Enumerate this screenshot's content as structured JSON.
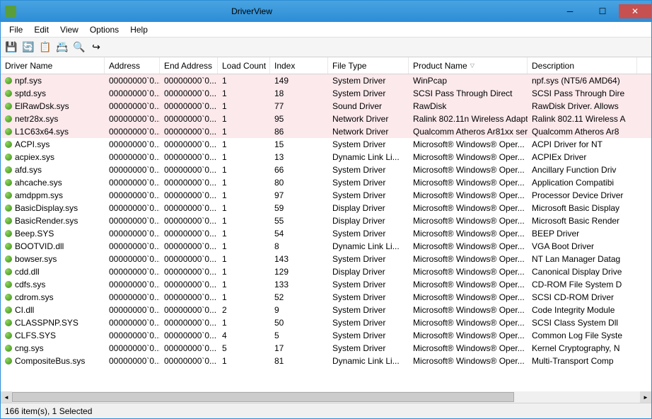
{
  "window": {
    "title": "DriverView"
  },
  "menu": {
    "items": [
      "File",
      "Edit",
      "View",
      "Options",
      "Help"
    ]
  },
  "toolbar": {
    "buttons": [
      {
        "name": "save-icon",
        "glyph": "💾"
      },
      {
        "name": "refresh-icon",
        "glyph": "🔄"
      },
      {
        "name": "copy-icon",
        "glyph": "📋"
      },
      {
        "name": "properties-icon",
        "glyph": "📇"
      },
      {
        "name": "find-icon",
        "glyph": "🔍"
      },
      {
        "name": "exit-icon",
        "glyph": "↪"
      }
    ]
  },
  "columns": [
    {
      "key": "name",
      "label": "Driver Name",
      "cls": "col-name"
    },
    {
      "key": "addr",
      "label": "Address",
      "cls": "col-addr"
    },
    {
      "key": "endaddr",
      "label": "End Address",
      "cls": "col-endaddr"
    },
    {
      "key": "load",
      "label": "Load Count",
      "cls": "col-load"
    },
    {
      "key": "index",
      "label": "Index",
      "cls": "col-index"
    },
    {
      "key": "filetype",
      "label": "File Type",
      "cls": "col-filetype"
    },
    {
      "key": "product",
      "label": "Product Name",
      "cls": "col-product",
      "sorted": true
    },
    {
      "key": "desc",
      "label": "Description",
      "cls": "col-desc"
    }
  ],
  "rows": [
    {
      "highlight": true,
      "name": "npf.sys",
      "addr": "00000000`0...",
      "endaddr": "00000000`0...",
      "load": "1",
      "index": "149",
      "filetype": "System Driver",
      "product": "WinPcap",
      "desc": "npf.sys (NT5/6 AMD64)"
    },
    {
      "highlight": true,
      "name": "sptd.sys",
      "addr": "00000000`0...",
      "endaddr": "00000000`0...",
      "load": "1",
      "index": "18",
      "filetype": "System Driver",
      "product": "SCSI Pass Through Direct",
      "desc": "SCSI Pass Through Dire"
    },
    {
      "highlight": true,
      "name": "ElRawDsk.sys",
      "addr": "00000000`0...",
      "endaddr": "00000000`0...",
      "load": "1",
      "index": "77",
      "filetype": "Sound Driver",
      "product": "RawDisk",
      "desc": "RawDisk Driver. Allows"
    },
    {
      "highlight": true,
      "name": "netr28x.sys",
      "addr": "00000000`0...",
      "endaddr": "00000000`0...",
      "load": "1",
      "index": "95",
      "filetype": "Network Driver",
      "product": "Ralink 802.11n Wireless Adapt...",
      "desc": "Ralink 802.11 Wireless A"
    },
    {
      "highlight": true,
      "name": "L1C63x64.sys",
      "addr": "00000000`0...",
      "endaddr": "00000000`0...",
      "load": "1",
      "index": "86",
      "filetype": "Network Driver",
      "product": "Qualcomm Atheros Ar81xx ser...",
      "desc": "Qualcomm Atheros Ar8"
    },
    {
      "highlight": false,
      "name": "ACPI.sys",
      "addr": "00000000`0...",
      "endaddr": "00000000`0...",
      "load": "1",
      "index": "15",
      "filetype": "System Driver",
      "product": "Microsoft® Windows® Oper...",
      "desc": "ACPI Driver for NT"
    },
    {
      "highlight": false,
      "name": "acpiex.sys",
      "addr": "00000000`0...",
      "endaddr": "00000000`0...",
      "load": "1",
      "index": "13",
      "filetype": "Dynamic Link Li...",
      "product": "Microsoft® Windows® Oper...",
      "desc": "ACPIEx Driver"
    },
    {
      "highlight": false,
      "name": "afd.sys",
      "addr": "00000000`0...",
      "endaddr": "00000000`0...",
      "load": "1",
      "index": "66",
      "filetype": "System Driver",
      "product": "Microsoft® Windows® Oper...",
      "desc": "Ancillary Function Driv"
    },
    {
      "highlight": false,
      "name": "ahcache.sys",
      "addr": "00000000`0...",
      "endaddr": "00000000`0...",
      "load": "1",
      "index": "80",
      "filetype": "System Driver",
      "product": "Microsoft® Windows® Oper...",
      "desc": "Application Compatibi"
    },
    {
      "highlight": false,
      "name": "amdppm.sys",
      "addr": "00000000`0...",
      "endaddr": "00000000`0...",
      "load": "1",
      "index": "97",
      "filetype": "System Driver",
      "product": "Microsoft® Windows® Oper...",
      "desc": "Processor Device Driver"
    },
    {
      "highlight": false,
      "name": "BasicDisplay.sys",
      "addr": "00000000`0...",
      "endaddr": "00000000`0...",
      "load": "1",
      "index": "59",
      "filetype": "Display Driver",
      "product": "Microsoft® Windows® Oper...",
      "desc": "Microsoft Basic Display"
    },
    {
      "highlight": false,
      "name": "BasicRender.sys",
      "addr": "00000000`0...",
      "endaddr": "00000000`0...",
      "load": "1",
      "index": "55",
      "filetype": "Display Driver",
      "product": "Microsoft® Windows® Oper...",
      "desc": "Microsoft Basic Render"
    },
    {
      "highlight": false,
      "name": "Beep.SYS",
      "addr": "00000000`0...",
      "endaddr": "00000000`0...",
      "load": "1",
      "index": "54",
      "filetype": "System Driver",
      "product": "Microsoft® Windows® Oper...",
      "desc": "BEEP Driver"
    },
    {
      "highlight": false,
      "name": "BOOTVID.dll",
      "addr": "00000000`0...",
      "endaddr": "00000000`0...",
      "load": "1",
      "index": "8",
      "filetype": "Dynamic Link Li...",
      "product": "Microsoft® Windows® Oper...",
      "desc": "VGA Boot Driver"
    },
    {
      "highlight": false,
      "name": "bowser.sys",
      "addr": "00000000`0...",
      "endaddr": "00000000`0...",
      "load": "1",
      "index": "143",
      "filetype": "System Driver",
      "product": "Microsoft® Windows® Oper...",
      "desc": "NT Lan Manager Datag"
    },
    {
      "highlight": false,
      "name": "cdd.dll",
      "addr": "00000000`0...",
      "endaddr": "00000000`0...",
      "load": "1",
      "index": "129",
      "filetype": "Display Driver",
      "product": "Microsoft® Windows® Oper...",
      "desc": "Canonical Display Drive"
    },
    {
      "highlight": false,
      "name": "cdfs.sys",
      "addr": "00000000`0...",
      "endaddr": "00000000`0...",
      "load": "1",
      "index": "133",
      "filetype": "System Driver",
      "product": "Microsoft® Windows® Oper...",
      "desc": "CD-ROM File System D"
    },
    {
      "highlight": false,
      "name": "cdrom.sys",
      "addr": "00000000`0...",
      "endaddr": "00000000`0...",
      "load": "1",
      "index": "52",
      "filetype": "System Driver",
      "product": "Microsoft® Windows® Oper...",
      "desc": "SCSI CD-ROM Driver"
    },
    {
      "highlight": false,
      "name": "CI.dll",
      "addr": "00000000`0...",
      "endaddr": "00000000`0...",
      "load": "2",
      "index": "9",
      "filetype": "System Driver",
      "product": "Microsoft® Windows® Oper...",
      "desc": "Code Integrity Module"
    },
    {
      "highlight": false,
      "name": "CLASSPNP.SYS",
      "addr": "00000000`0...",
      "endaddr": "00000000`0...",
      "load": "1",
      "index": "50",
      "filetype": "System Driver",
      "product": "Microsoft® Windows® Oper...",
      "desc": "SCSI Class System Dll"
    },
    {
      "highlight": false,
      "name": "CLFS.SYS",
      "addr": "00000000`0...",
      "endaddr": "00000000`0...",
      "load": "4",
      "index": "5",
      "filetype": "System Driver",
      "product": "Microsoft® Windows® Oper...",
      "desc": "Common Log File Syste"
    },
    {
      "highlight": false,
      "name": "cng.sys",
      "addr": "00000000`0...",
      "endaddr": "00000000`0...",
      "load": "5",
      "index": "17",
      "filetype": "System Driver",
      "product": "Microsoft® Windows® Oper...",
      "desc": "Kernel Cryptography, N"
    },
    {
      "highlight": false,
      "name": "CompositeBus.sys",
      "addr": "00000000`0...",
      "endaddr": "00000000`0...",
      "load": "1",
      "index": "81",
      "filetype": "Dynamic Link Li...",
      "product": "Microsoft® Windows® Oper...",
      "desc": "Multi-Transport Comp"
    }
  ],
  "status": {
    "text": "166 item(s), 1 Selected"
  }
}
